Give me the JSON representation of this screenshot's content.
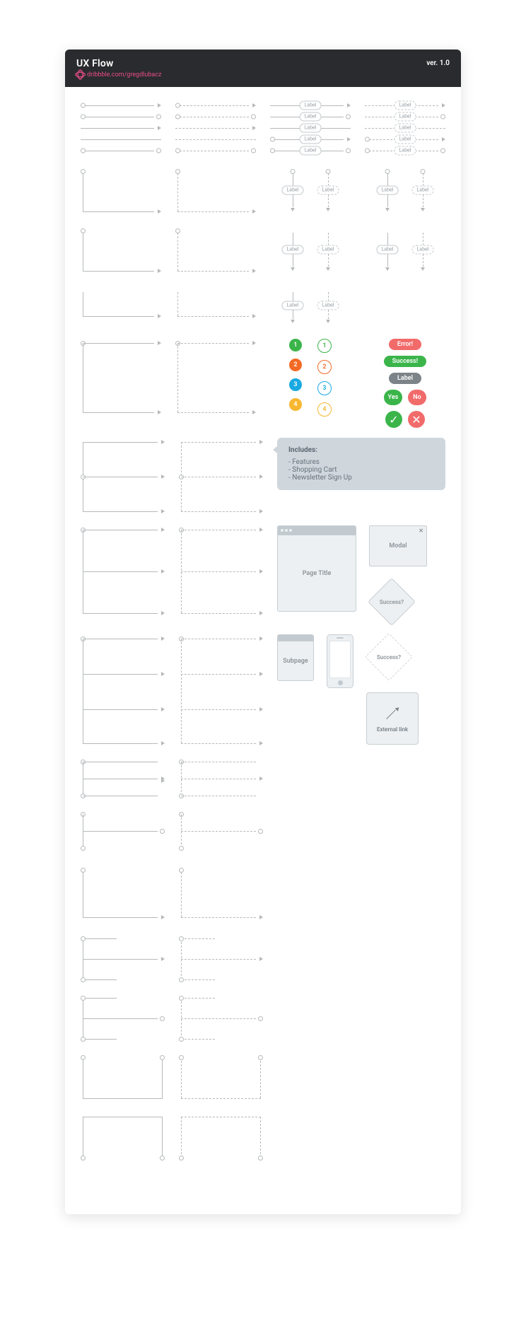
{
  "header": {
    "title": "UX Flow",
    "subtitle": "dribbble.com/gregdlubacz",
    "version": "ver. 1.0"
  },
  "label_text": "Label",
  "badges": {
    "n1": "1",
    "n2": "2",
    "n3": "3",
    "n4": "4"
  },
  "status": {
    "error": "Error!",
    "success": "Success!",
    "label": "Label",
    "yes": "Yes",
    "no": "No"
  },
  "note": {
    "title": "Includes:",
    "items": [
      "Features",
      "Shopping Cart",
      "Newsletter Sign Up"
    ]
  },
  "wire": {
    "page_title": "Page Title",
    "modal": "Modal",
    "success_q": "Success?",
    "subpage": "Subpage",
    "external": "External link"
  }
}
